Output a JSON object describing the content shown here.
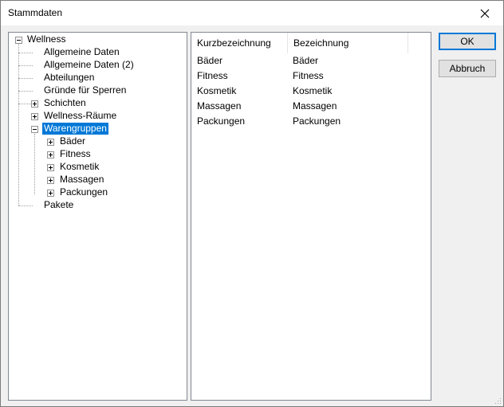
{
  "window": {
    "title": "Stammdaten"
  },
  "tree": {
    "nodes": [
      {
        "label": "Wellness"
      },
      {
        "label": "Allgemeine Daten"
      },
      {
        "label": "Allgemeine Daten (2)"
      },
      {
        "label": "Abteilungen"
      },
      {
        "label": "Gründe für Sperren"
      },
      {
        "label": "Schichten"
      },
      {
        "label": "Wellness-Räume"
      },
      {
        "label": "Warengruppen",
        "selected": true
      },
      {
        "label": "Bäder"
      },
      {
        "label": "Fitness"
      },
      {
        "label": "Kosmetik"
      },
      {
        "label": "Massagen"
      },
      {
        "label": "Packungen"
      },
      {
        "label": "Pakete"
      }
    ]
  },
  "list": {
    "columns": [
      "Kurzbezeichnung",
      "Bezeichnung"
    ],
    "rows": [
      [
        "Bäder",
        "Bäder"
      ],
      [
        "Fitness",
        "Fitness"
      ],
      [
        "Kosmetik",
        "Kosmetik"
      ],
      [
        "Massagen",
        "Massagen"
      ],
      [
        "Packungen",
        "Packungen"
      ]
    ]
  },
  "buttons": {
    "ok": "OK",
    "cancel": "Abbruch"
  },
  "colors": {
    "selection": "#0078d7",
    "default_button_border": "#0078d7"
  },
  "icons": {
    "close": "close-icon",
    "expand": "expand-icon",
    "collapse": "collapse-icon",
    "resize": "resize-grip-icon"
  }
}
